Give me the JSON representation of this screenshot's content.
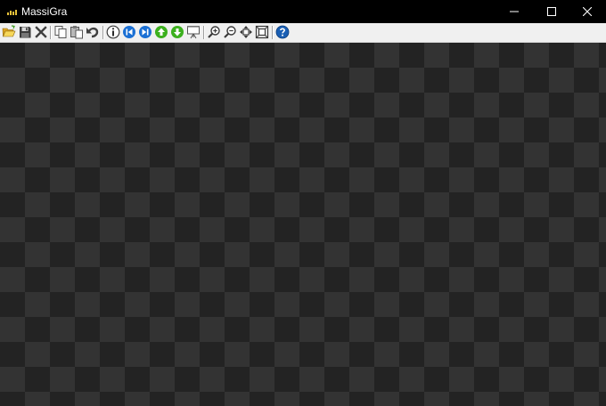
{
  "window": {
    "title": "MassiGra"
  },
  "window_controls": [
    "minimize-icon",
    "maximize-icon",
    "close-icon"
  ],
  "toolbar": {
    "buttons": [
      "open-icon",
      "save-icon",
      "delete-icon",
      "copy-icon",
      "paste-icon",
      "undo-icon",
      "info-icon",
      "first-image-icon",
      "last-image-icon",
      "previous-image-icon",
      "next-image-icon",
      "slideshow-icon",
      "zoom-in-icon",
      "zoom-out-icon",
      "fit-move-icon",
      "fit-window-icon",
      "help-icon"
    ]
  },
  "colors": {
    "titlebar": "#000000",
    "toolbar": "#f0f0f0",
    "checker_dark": "#232323",
    "checker_light": "#333333",
    "blue_button": "#1a6fd4",
    "green_button": "#3cb01e"
  }
}
